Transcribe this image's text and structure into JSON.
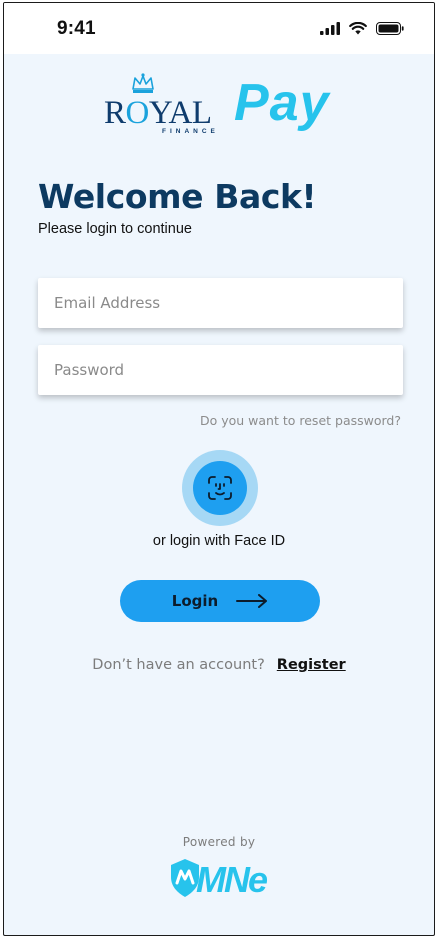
{
  "status_bar": {
    "time": "9:41"
  },
  "logo": {
    "royal_prefix": "R",
    "royal_o": "O",
    "royal_suffix": "YAL",
    "finance": "FINANCE",
    "pay": "Pay"
  },
  "heading": {
    "title": "Welcome Back!",
    "subtitle": "Please login to continue"
  },
  "form": {
    "email_placeholder": "Email Address",
    "email_value": "",
    "password_placeholder": "Password",
    "password_value": "",
    "reset_link": "Do you want to reset password?"
  },
  "face_id": {
    "label": "or login with Face ID"
  },
  "login_button": {
    "label": "Login"
  },
  "register": {
    "question": "Don’t have an account?",
    "link": "Register"
  },
  "footer": {
    "powered_by": "Powered by",
    "brand": "MNe"
  },
  "colors": {
    "background": "#eff6fd",
    "primary": "#1e9ff0",
    "primary_light": "#a6d8f5",
    "heading": "#0d3a61",
    "logo_cyan": "#27c3ec"
  }
}
